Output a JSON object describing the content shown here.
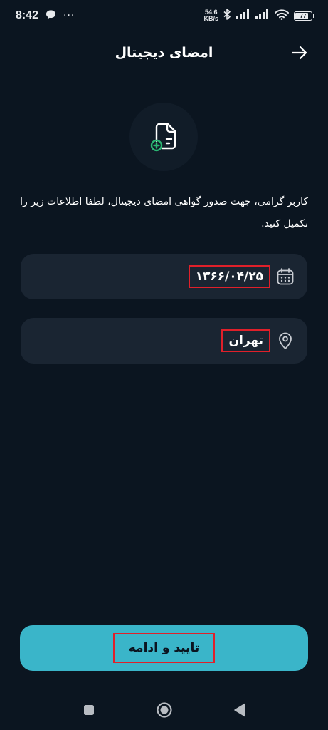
{
  "status_bar": {
    "time": "8:42",
    "more": "···",
    "net_speed_value": "54.6",
    "net_speed_unit": "KB/s",
    "battery": "77"
  },
  "header": {
    "title": "امضای دیجیتال"
  },
  "description": "کاربر گرامی، جهت صدور گواهی امضای دیجیتال، لطفا اطلاعات زیر را تکمیل کنید.",
  "fields": {
    "birth_date": "۱۳۶۶/۰۴/۲۵",
    "city": "تهران"
  },
  "confirm_button": {
    "label": "تایید و ادامه"
  },
  "colors": {
    "background": "#0b1520",
    "field": "#1a2532",
    "accent": "#3ab5c9",
    "green": "#2bb673",
    "highlight": "#e0202a"
  },
  "icons": {
    "back": "arrow-right-icon",
    "hero": "document-add-icon",
    "date": "calendar-icon",
    "city": "location-pin-icon"
  }
}
